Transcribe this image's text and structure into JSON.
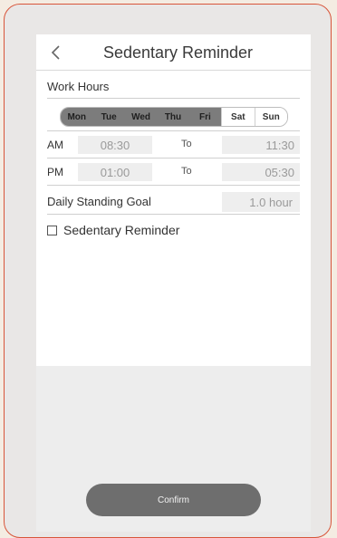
{
  "header": {
    "title": "Sedentary Reminder"
  },
  "work_hours": {
    "label": "Work Hours",
    "days": [
      {
        "label": "Mon",
        "selected": true
      },
      {
        "label": "Tue",
        "selected": true
      },
      {
        "label": "Wed",
        "selected": true
      },
      {
        "label": "Thu",
        "selected": true
      },
      {
        "label": "Fri",
        "selected": true
      },
      {
        "label": "Sat",
        "selected": false
      },
      {
        "label": "Sun",
        "selected": false
      }
    ]
  },
  "am": {
    "label": "AM",
    "start": "08:30",
    "to": "To",
    "end": "11:30"
  },
  "pm": {
    "label": "PM",
    "start": "01:00",
    "to": "To",
    "end": "05:30"
  },
  "goal": {
    "label": "Daily Standing Goal",
    "value": "1.0 hour"
  },
  "reminder": {
    "label": "Sedentary Reminder",
    "checked": false
  },
  "confirm_label": "Confirm"
}
